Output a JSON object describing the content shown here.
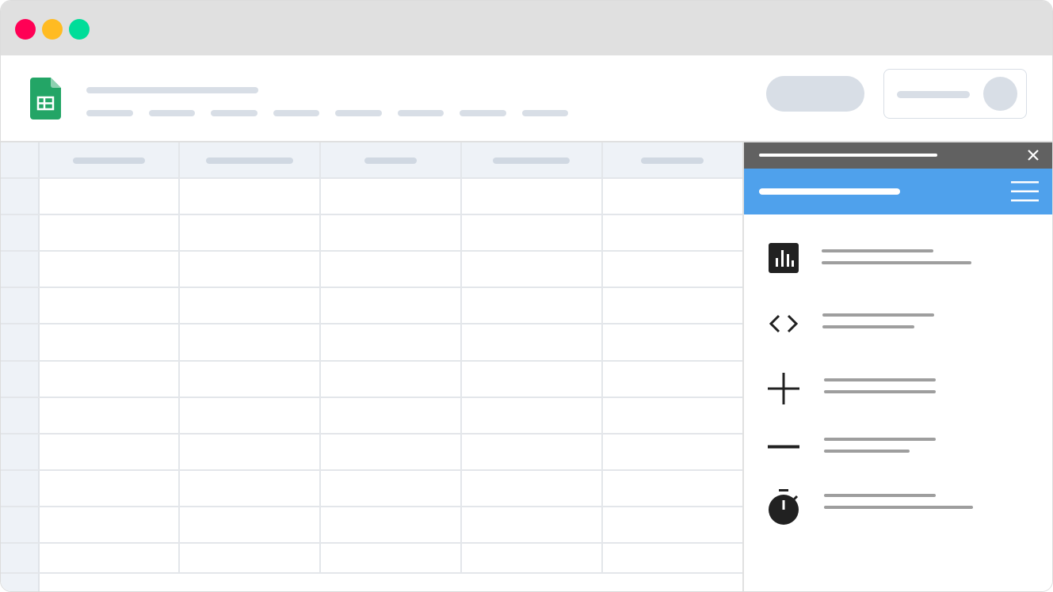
{
  "window": {
    "controls": [
      {
        "name": "close",
        "color": "#ff0055"
      },
      {
        "name": "minimize",
        "color": "#ffbb22"
      },
      {
        "name": "maximize",
        "color": "#00dd99"
      }
    ]
  },
  "app": {
    "icon": "sheets-icon",
    "brand_color": "#23a566"
  },
  "colors": {
    "placeholder": "#d8dee6",
    "header_fill": "#eef2f7",
    "panel_dark": "#616161",
    "panel_accent": "#4fa1ec",
    "menu_line": "#9e9e9e",
    "icon_dark": "#212121"
  },
  "panel": {
    "menu_icon": "hamburger-menu-icon",
    "close_icon": "close-icon",
    "items": [
      {
        "icon": "bar-chart-icon"
      },
      {
        "icon": "code-icon"
      },
      {
        "icon": "plus-icon"
      },
      {
        "icon": "minus-icon"
      },
      {
        "icon": "stopwatch-icon"
      }
    ]
  }
}
